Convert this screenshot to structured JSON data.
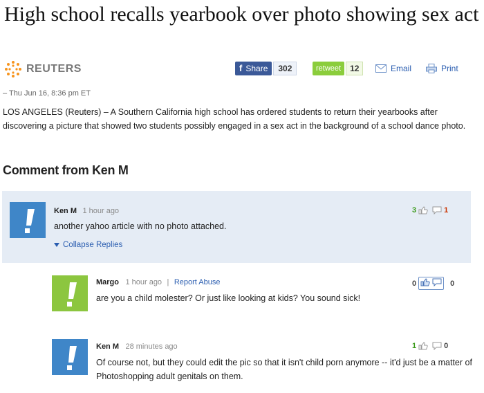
{
  "article": {
    "headline": "High school recalls yearbook over photo showing sex act",
    "source": "REUTERS",
    "dateline": "– Thu Jun 16, 8:36 pm ET",
    "body": "LOS ANGELES (Reuters) – A Southern California high school has ordered students to return their yearbooks after discovering a picture that showed two students possibly engaged in a sex act in the background of a school dance photo."
  },
  "toolbar": {
    "share_label": "Share",
    "share_icon": "f",
    "share_count": "302",
    "retweet_label": "retweet",
    "retweet_count": "12",
    "email_label": "Email",
    "print_label": "Print"
  },
  "comments_heading": "Comment from Ken M",
  "comments": [
    {
      "author": "Ken M",
      "time": "1 hour ago",
      "text": "another yahoo article with no photo attached.",
      "thumbs_up": "3",
      "thumbs_down": "1",
      "collapse_label": "Collapse Replies",
      "avatar_color": "#3f86c8"
    },
    {
      "author": "Margo",
      "time": "1 hour ago",
      "separator": "|",
      "report_label": "Report Abuse",
      "text": "are you a child molester? Or just like looking at kids? You sound sick!",
      "thumbs_up": "0",
      "thumbs_down": "0",
      "avatar_color": "#8cc63f"
    },
    {
      "author": "Ken M",
      "time": "28 minutes ago",
      "text": "Of course not, but they could edit the pic so that it isn't child porn anymore -- it'd just be a matter of Photoshopping adult genitals on them.",
      "thumbs_up": "1",
      "thumbs_down": "0",
      "avatar_color": "#3f86c8"
    }
  ],
  "colors": {
    "facebook": "#3b5998",
    "retweet": "#8bcd3c",
    "link": "#2a5db0",
    "highlight_bg": "#e5ecf5",
    "upvote": "#3a9a1a",
    "downvote": "#cc3300"
  }
}
